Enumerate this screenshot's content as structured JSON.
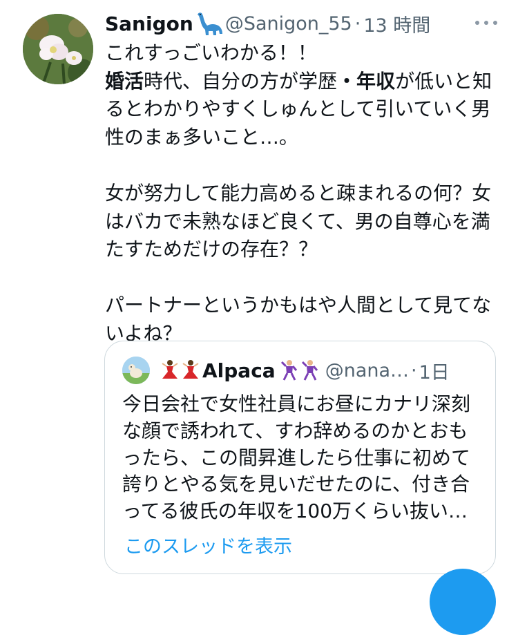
{
  "tweet": {
    "author_name": "Sanigon",
    "author_emoji": "sauropod-emoji",
    "handle": "@Sanigon_55",
    "separator": "·",
    "time": "13 時間",
    "line1": "これすっごいわかる！！",
    "bold1": "婚活",
    "seg1": "時代、自分の方が学歴",
    "dot": "・",
    "bold2": "年収",
    "seg2": "が低いと知",
    "line3": "るとわかりやすくしゅんとして引いていく男",
    "line4": "性のまぁ多いこと…。",
    "line5": "女が努力して能力高めると疎まれるの何？女",
    "line6": "はバカで未熟なほど良くて、男の自尊心を満",
    "line7": "たすためだけの存在？？",
    "line8": "パートナーというかもはや人間として見てな",
    "line9": "いよね？"
  },
  "quote": {
    "name": "Alpaca",
    "handle": "@nana…",
    "separator": "·",
    "time": "1日",
    "text_lines": [
      "今日会社で女性社員にお昼にカナリ深刻",
      "な顔で誘われて、すわ辞めるのかとおも",
      "ったら、この間昇進したら仕事に初めて",
      "誇りとやる気を見いだせたのに、付き合",
      "ってる彼氏の年収を100万くらい抜い…"
    ],
    "show_thread": "このスレッドを表示"
  },
  "colors": {
    "text": "#0f1419",
    "secondary": "#536471",
    "accent": "#1d9bf0",
    "border": "#cfd9de"
  },
  "icons": {
    "more": "more-icon",
    "dancer": "dancer-emoji",
    "man_dancing": "man-dancing-emoji"
  }
}
